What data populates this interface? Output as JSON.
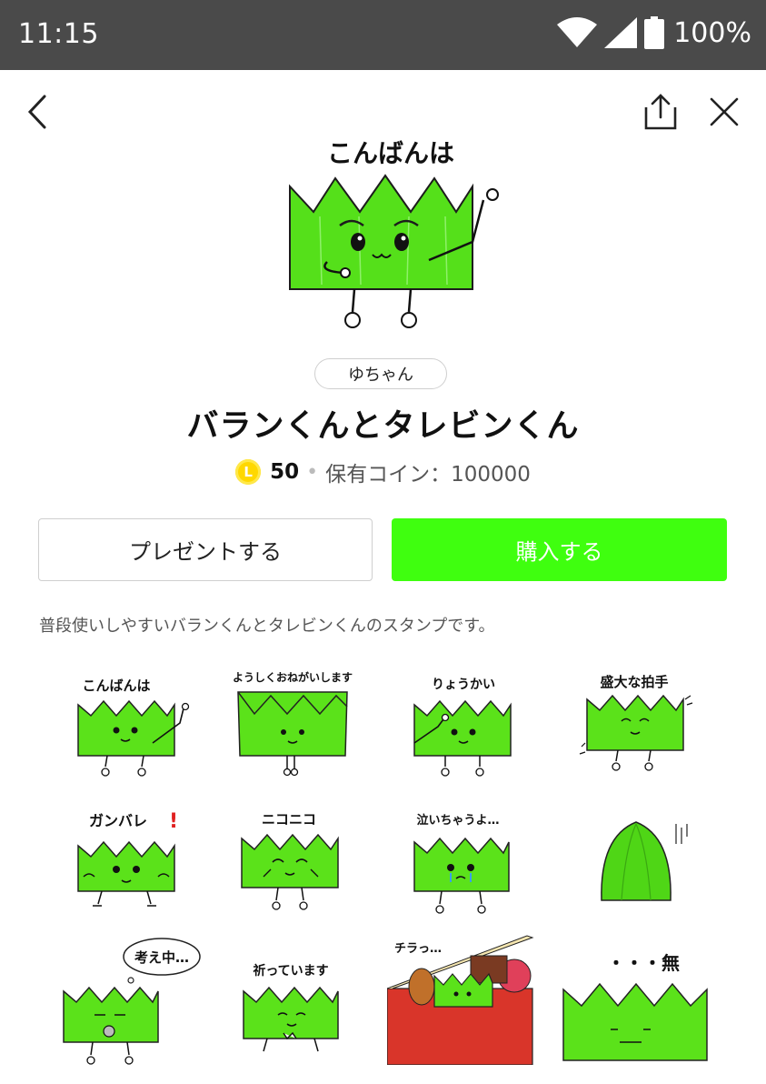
{
  "status_bar": {
    "time": "11:15",
    "battery": "100%"
  },
  "header": {
    "back_icon": "chevron-left-icon",
    "share_icon": "share-icon",
    "close_icon": "close-icon"
  },
  "hero_stamp": {
    "caption": "こんばんは"
  },
  "author": "ゆちゃん",
  "title": "バランくんとタレビンくん",
  "price": {
    "coin_label": "L",
    "value": "50",
    "separator": "•",
    "owned": "保有コイン：100000"
  },
  "buttons": {
    "present": "プレゼントする",
    "buy": "購入する"
  },
  "description": "普段使いしやすいバランくんとタレビンくんのスタンプです。",
  "stamps": [
    {
      "caption": "こんばんは"
    },
    {
      "caption": "ようしくおねがいします"
    },
    {
      "caption": "りょうかい"
    },
    {
      "caption": "盛大な拍手"
    },
    {
      "caption": "ガンバレ"
    },
    {
      "caption": "ニコニコ"
    },
    {
      "caption": "泣いちゃうよ…"
    },
    {
      "caption": ""
    },
    {
      "caption": "考え中…"
    },
    {
      "caption": "祈っています"
    },
    {
      "caption": "チラっ…"
    },
    {
      "caption": "・・・無"
    }
  ],
  "colors": {
    "accent": "#3fff0f",
    "baran_green": "#5be21a",
    "coin": "#ffd800",
    "status_bar": "#4a4a4a"
  }
}
